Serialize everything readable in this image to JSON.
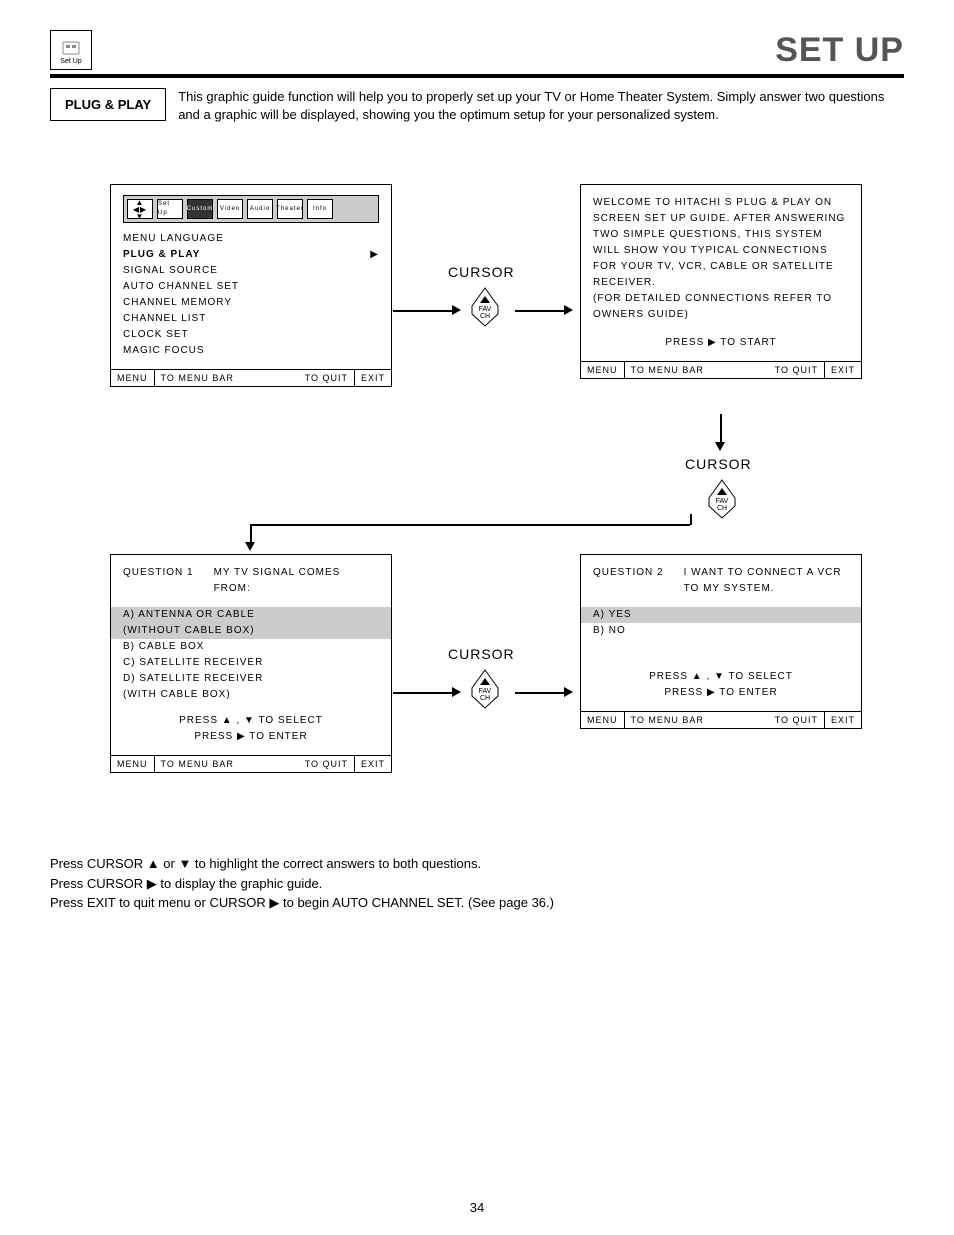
{
  "header": {
    "icon_label": "Set Up",
    "page_title": "SET UP"
  },
  "intro": {
    "box_label": "PLUG & PLAY",
    "text": "This graphic guide function will help you to properly set up your TV or Home Theater System.  Simply answer two questions and a graphic will be displayed, showing you the optimum setup for your personalized system."
  },
  "cursor_label": "CURSOR",
  "remote_btn": {
    "line1": "FAV",
    "line2": "CH"
  },
  "menu_icons": [
    "Set Up",
    "Custom",
    "Video",
    "Audio",
    "Theater",
    "Info"
  ],
  "screen1": {
    "items": [
      "MENU LANGUAGE",
      "PLUG & PLAY",
      "SIGNAL SOURCE",
      "AUTO CHANNEL SET",
      "CHANNEL MEMORY",
      "CHANNEL LIST",
      "CLOCK SET",
      "MAGIC FOCUS"
    ],
    "selected_index": 1
  },
  "screen2": {
    "body": "WELCOME TO HITACHI S PLUG & PLAY ON SCREEN SET UP GUIDE. AFTER ANSWERING TWO SIMPLE QUESTIONS, THIS SYSTEM WILL SHOW YOU TYPICAL CONNECTIONS FOR YOUR TV, VCR, CABLE OR SATELLITE RECEIVER.",
    "body2": "(FOR DETAILED CONNECTIONS REFER TO OWNERS GUIDE)",
    "press": "PRESS ▶ TO START"
  },
  "screen3": {
    "question_label": "QUESTION 1",
    "question_text": "MY TV SIGNAL COMES FROM:",
    "options": [
      "A) ANTENNA OR CABLE",
      "    (WITHOUT CABLE BOX)",
      "B) CABLE BOX",
      "C) SATELLITE RECEIVER",
      "D) SATELLITE RECEIVER",
      "    (WITH CABLE BOX)"
    ],
    "highlight_rows": [
      0,
      1
    ],
    "press1": "PRESS  ▲ , ▼  TO SELECT",
    "press2": "PRESS ▶ TO ENTER"
  },
  "screen4": {
    "question_label": "QUESTION 2",
    "question_text": "I WANT TO CONNECT A VCR TO MY SYSTEM.",
    "options": [
      "A) YES",
      "B) NO"
    ],
    "highlight_rows": [
      0
    ],
    "press1": "PRESS  ▲ , ▼  TO SELECT",
    "press2": "PRESS ▶ TO ENTER"
  },
  "footer": {
    "menu": "MENU",
    "bar": "TO MENU BAR",
    "quit": "TO QUIT",
    "exit": "EXIT"
  },
  "instructions": {
    "line1": "Press  CURSOR ▲ or ▼ to highlight the correct answers to both questions.",
    "line2": "Press CURSOR ▶ to display the graphic guide.",
    "line3": "Press EXIT to quit menu or CURSOR ▶ to begin AUTO CHANNEL SET. (See page 36.)"
  },
  "page_number": "34"
}
